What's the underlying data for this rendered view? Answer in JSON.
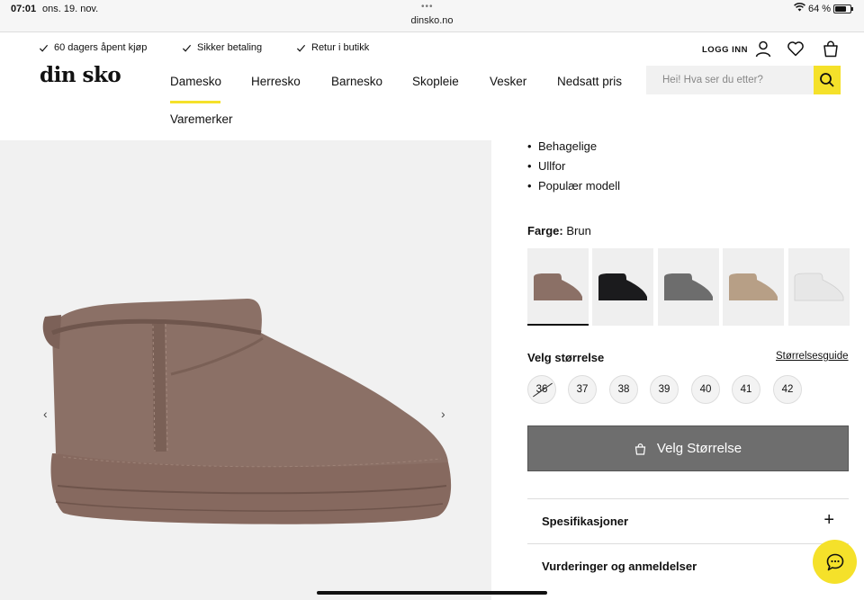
{
  "status": {
    "time": "07:01",
    "date": "ons. 19. nov.",
    "url": "dinsko.no",
    "battery": "64 %",
    "battery_level": 0.64
  },
  "header": {
    "usps": [
      "60 dagers åpent kjøp",
      "Sikker betaling",
      "Retur i butikk"
    ],
    "logo": "din sko",
    "login": "LOGG INN",
    "search_placeholder": "Hei! Hva ser du etter?",
    "nav": [
      "Damesko",
      "Herresko",
      "Barnesko",
      "Skopleie",
      "Vesker",
      "Nedsatt pris",
      "Varemerker"
    ]
  },
  "product": {
    "features": [
      "Behagelige",
      "Ullfor",
      "Populær modell"
    ],
    "color_label": "Farge:",
    "color_value": "Brun",
    "swatches": [
      {
        "name": "brown",
        "color": "#8b7066"
      },
      {
        "name": "black",
        "color": "#1b1b1d"
      },
      {
        "name": "grey",
        "color": "#6d6d6d"
      },
      {
        "name": "beige",
        "color": "#b79f86"
      },
      {
        "name": "white",
        "color": "#e7e7e7"
      }
    ],
    "size_title": "Velg størrelse",
    "size_guide": "Størrelsesguide",
    "sizes": [
      "36",
      "37",
      "38",
      "39",
      "40",
      "41",
      "42"
    ],
    "add_button": "Velg Størrelse",
    "accordions": [
      "Spesifikasjoner",
      "Vurderinger og anmeldelser"
    ]
  },
  "colors": {
    "accent": "#f5e12a",
    "button": "#6e6e6e",
    "shoe": "#8b7066"
  }
}
